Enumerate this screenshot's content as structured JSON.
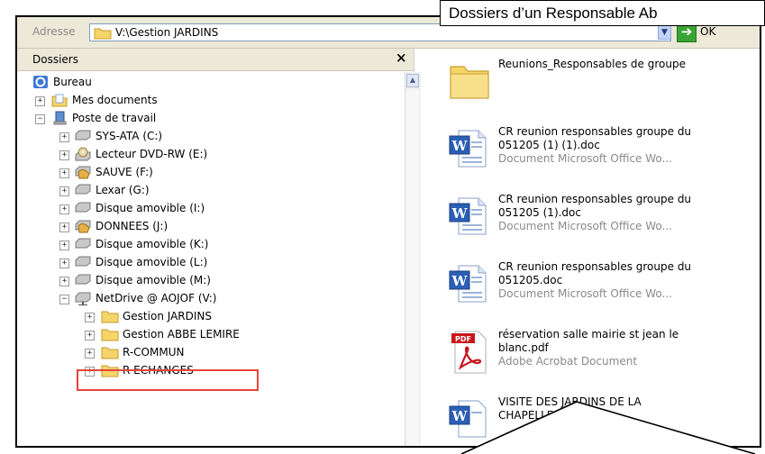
{
  "caption": "Dossiers d’un Responsable Ab",
  "address_bar": {
    "label": "Adresse",
    "value": "V:\\Gestion  JARDINS",
    "go_label": "OK"
  },
  "folders_pane": {
    "title": "Dossiers",
    "close_glyph": "×",
    "tree": [
      {
        "label": "Bureau",
        "icon": "desktop-icon"
      },
      {
        "label": "Mes documents",
        "icon": "my-documents-icon",
        "expander": "+"
      },
      {
        "label": "Poste de travail",
        "icon": "computer-icon",
        "expander": "−"
      },
      {
        "label": "SYS-ATA (C:)",
        "icon": "drive-icon",
        "expander": "+"
      },
      {
        "label": "Lecteur DVD-RW (E:)",
        "icon": "dvd-drive-icon",
        "expander": "+"
      },
      {
        "label": "SAUVE (F:)",
        "icon": "shared-drive-icon",
        "expander": "+"
      },
      {
        "label": "Lexar (G:)",
        "icon": "drive-icon",
        "expander": "+"
      },
      {
        "label": "Disque amovible (I:)",
        "icon": "drive-icon",
        "expander": "+"
      },
      {
        "label": "DONNEES (J:)",
        "icon": "shared-drive-icon",
        "expander": "+"
      },
      {
        "label": "Disque amovible (K:)",
        "icon": "drive-icon",
        "expander": "+"
      },
      {
        "label": "Disque amovible (L:)",
        "icon": "drive-icon",
        "expander": "+"
      },
      {
        "label": "Disque amovible (M:)",
        "icon": "drive-icon",
        "expander": "+"
      },
      {
        "label": "NetDrive @ AOJOF (V:)",
        "icon": "network-drive-icon",
        "expander": "−"
      },
      {
        "label": "Gestion  JARDINS",
        "icon": "folder-icon",
        "expander": "+",
        "selected": true
      },
      {
        "label": "Gestion ABBE LEMIRE",
        "icon": "folder-icon",
        "expander": "+"
      },
      {
        "label": "R-COMMUN",
        "icon": "folder-icon",
        "expander": "+"
      },
      {
        "label": "R-ECHANGES",
        "icon": "folder-icon",
        "expander": "+"
      }
    ]
  },
  "files": [
    {
      "name": "Reunions_Responsables de groupe",
      "type": "",
      "icon": "folder-icon"
    },
    {
      "name": "CR reunion responsables groupe du 051205 (1) (1).doc",
      "type": "Document Microsoft Office Wo...",
      "icon": "word-document-icon"
    },
    {
      "name": "CR reunion responsables groupe du 051205 (1).doc",
      "type": "Document Microsoft Office Wo...",
      "icon": "word-document-icon"
    },
    {
      "name": "CR reunion responsables groupe du 051205.doc",
      "type": "Document Microsoft Office Wo...",
      "icon": "word-document-icon"
    },
    {
      "name": "réservation salle mairie st jean le blanc.pdf",
      "type": "Adobe Acrobat Document",
      "icon": "pdf-document-icon"
    },
    {
      "name": "VISITE DES JARDINS DE LA CHAPELLE",
      "type": "",
      "icon": "word-document-icon"
    }
  ],
  "colors": {
    "highlight": "#e8443a",
    "folder": "#f5d569",
    "word_blue": "#2b5fb5",
    "pdf_red": "#c8161d",
    "go_green": "#3aa335"
  }
}
